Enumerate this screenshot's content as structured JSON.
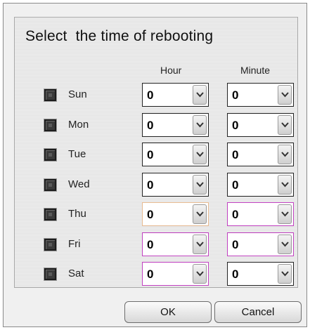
{
  "dialog": {
    "title": "Select  the time of rebooting",
    "hour_header": "Hour",
    "minute_header": "Minute",
    "ok_label": "OK",
    "cancel_label": "Cancel"
  },
  "days": [
    {
      "label": "Sun",
      "hour": "0",
      "minute": "0",
      "checked": false
    },
    {
      "label": "Mon",
      "hour": "0",
      "minute": "0",
      "checked": false
    },
    {
      "label": "Tue",
      "hour": "0",
      "minute": "0",
      "checked": false
    },
    {
      "label": "Wed",
      "hour": "0",
      "minute": "0",
      "checked": false
    },
    {
      "label": "Thu",
      "hour": "0",
      "minute": "0",
      "checked": false
    },
    {
      "label": "Fri",
      "hour": "0",
      "minute": "0",
      "checked": false
    },
    {
      "label": "Sat",
      "hour": "0",
      "minute": "0",
      "checked": false
    }
  ],
  "colors": {
    "focus_border": "#c040c0",
    "hover_border": "#e6b990"
  },
  "icons": {
    "dropdown": "chevron-down-icon"
  }
}
